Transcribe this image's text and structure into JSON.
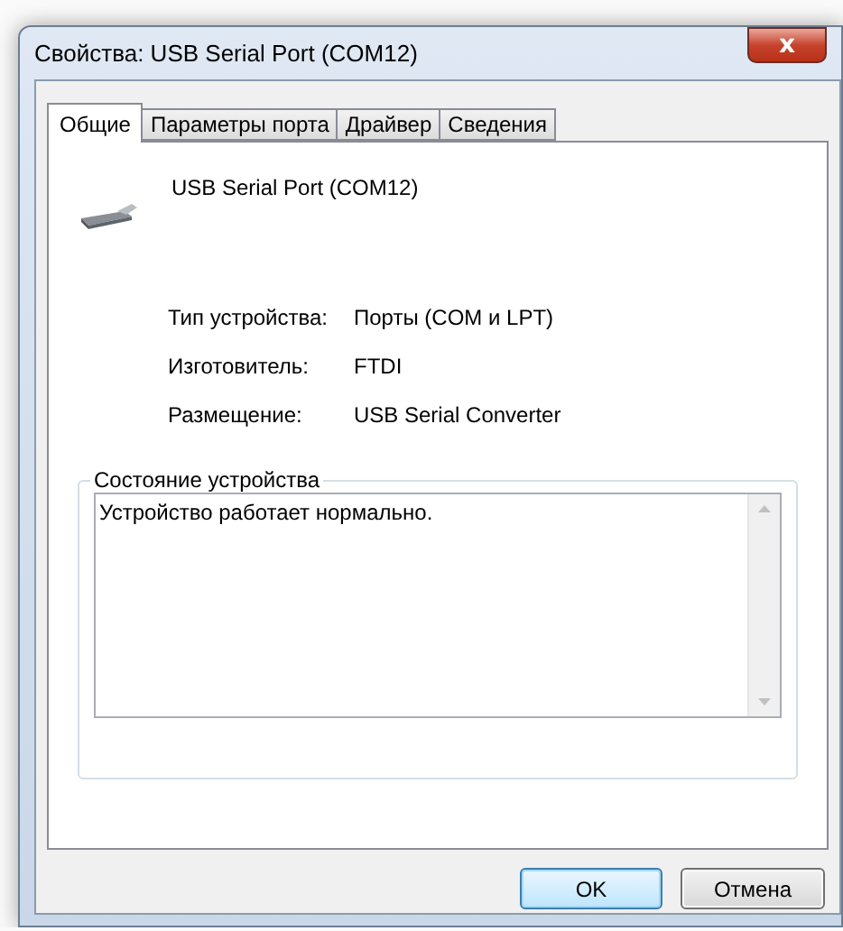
{
  "window": {
    "title": "Свойства: USB Serial Port (COM12)",
    "close": "x"
  },
  "tabs": [
    {
      "label": "Общие",
      "selected": true
    },
    {
      "label": "Параметры порта",
      "selected": false
    },
    {
      "label": "Драйвер",
      "selected": false
    },
    {
      "label": "Сведения",
      "selected": false
    }
  ],
  "device": {
    "name": "USB Serial Port (COM12)"
  },
  "properties": [
    {
      "label": "Тип устройства:",
      "value": "Порты (COM и LPT)"
    },
    {
      "label": "Изготовитель:",
      "value": "FTDI"
    },
    {
      "label": "Размещение:",
      "value": "USB Serial Converter"
    }
  ],
  "status": {
    "title": "Состояние устройства",
    "text": "Устройство работает нормально."
  },
  "buttons": [
    {
      "label": "OK",
      "default": true
    },
    {
      "label": "Отмена",
      "default": false
    }
  ]
}
